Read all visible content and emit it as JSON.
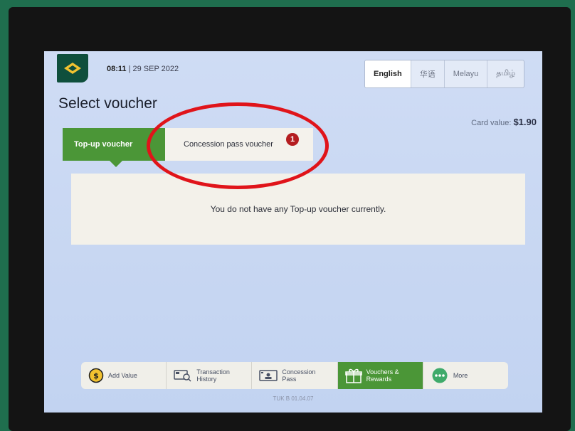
{
  "header": {
    "time": "08:11",
    "date": "| 29 SEP 2022",
    "languages": [
      {
        "label": "English",
        "active": true
      },
      {
        "label": "华语",
        "active": false
      },
      {
        "label": "Melayu",
        "active": false
      },
      {
        "label": "தமிழ்",
        "active": false
      }
    ]
  },
  "page": {
    "title": "Select voucher",
    "card_value_label": "Card value:",
    "card_value": "$1.90"
  },
  "tabs": {
    "topup_label": "Top-up voucher",
    "concession_label": "Concession pass voucher",
    "concession_badge": "1"
  },
  "voucher_panel": {
    "message": "You do not have any Top-up voucher currently."
  },
  "bottom_nav": {
    "items": [
      {
        "label": "Add Value",
        "icon": "coin-icon"
      },
      {
        "label": "Transaction\nHistory",
        "icon": "card-search-icon"
      },
      {
        "label": "Concession\nPass",
        "icon": "id-card-icon"
      },
      {
        "label": "Vouchers &\nRewards",
        "icon": "gift-icon",
        "active": true
      },
      {
        "label": "More",
        "icon": "more-dots-icon"
      }
    ]
  },
  "footer": {
    "version": "TUK B 01.04.07"
  },
  "colors": {
    "accent_green": "#4b9637",
    "brand_dark_green": "#0f4f3c",
    "badge_red": "#b41d20",
    "annotation_red": "#e0141a"
  }
}
